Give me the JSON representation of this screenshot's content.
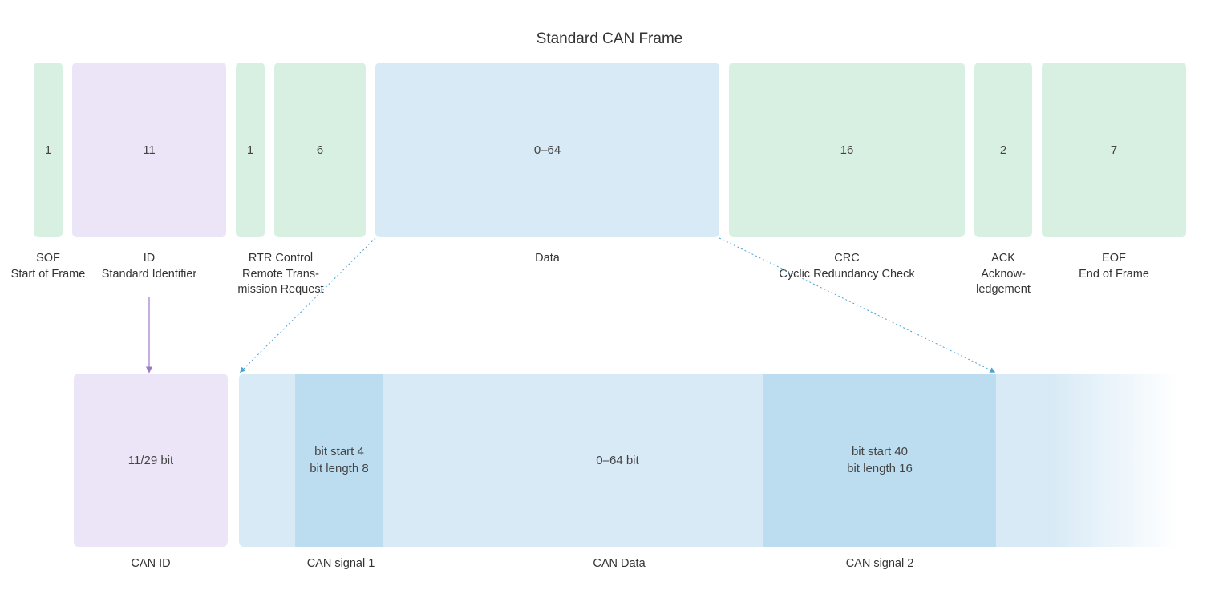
{
  "title": "Standard CAN Frame",
  "colors": {
    "green": "#d8f0e1",
    "lilac": "#ece4f7",
    "blue": "#d8eaf6",
    "blue2": "#bcdcf0",
    "arrow_purple": "#9d7ac8",
    "arrow_blue": "#4aa4d4"
  },
  "frame_fields": [
    {
      "id": "sof",
      "bits": "1",
      "short": "SOF",
      "long": "Start of Frame"
    },
    {
      "id": "id",
      "bits": "11",
      "short": "ID",
      "long": "Standard Identifier"
    },
    {
      "id": "rtr",
      "bits": "1",
      "short": "RTR Control",
      "long": "Remote Trans-\nmission Request"
    },
    {
      "id": "ctrl",
      "bits": "6",
      "short": "",
      "long": ""
    },
    {
      "id": "data",
      "bits": "0–64",
      "short": "Data",
      "long": ""
    },
    {
      "id": "crc",
      "bits": "16",
      "short": "CRC",
      "long": "Cyclic Redundancy Check"
    },
    {
      "id": "ack",
      "bits": "2",
      "short": "ACK",
      "long": "Acknow-\nledgement"
    },
    {
      "id": "eof",
      "bits": "7",
      "short": "EOF",
      "long": "End of Frame"
    }
  ],
  "detail": {
    "can_id": {
      "label": "CAN ID",
      "value": "11/29 bit"
    },
    "can_data": {
      "label": "CAN Data",
      "value": "0–64 bit"
    },
    "signal1": {
      "label": "CAN signal 1",
      "line1": "bit start 4",
      "line2": "bit length 8"
    },
    "signal2": {
      "label": "CAN signal 2",
      "line1": "bit start 40",
      "line2": "bit length 16"
    }
  }
}
